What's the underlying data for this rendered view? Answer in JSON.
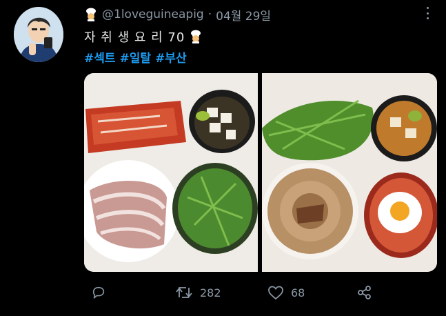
{
  "tweet": {
    "handle": "@1loveguineapig",
    "separator": "·",
    "date": "04월 29일",
    "text": "자 취 생 요 리 70",
    "hashtags": [
      "#섹트",
      "#일탈",
      "#부산"
    ],
    "emoji_icon": "cook-emoji-icon"
  },
  "actions": {
    "reply": {
      "icon": "reply-icon",
      "count": ""
    },
    "retweet": {
      "icon": "retweet-icon",
      "count": "282"
    },
    "like": {
      "icon": "heart-icon",
      "count": "68"
    },
    "share": {
      "icon": "share-icon",
      "count": ""
    }
  },
  "colors": {
    "background": "#000000",
    "text": "#e7e9ea",
    "muted": "#8b98a5",
    "hashtag": "#1d9bf0"
  }
}
